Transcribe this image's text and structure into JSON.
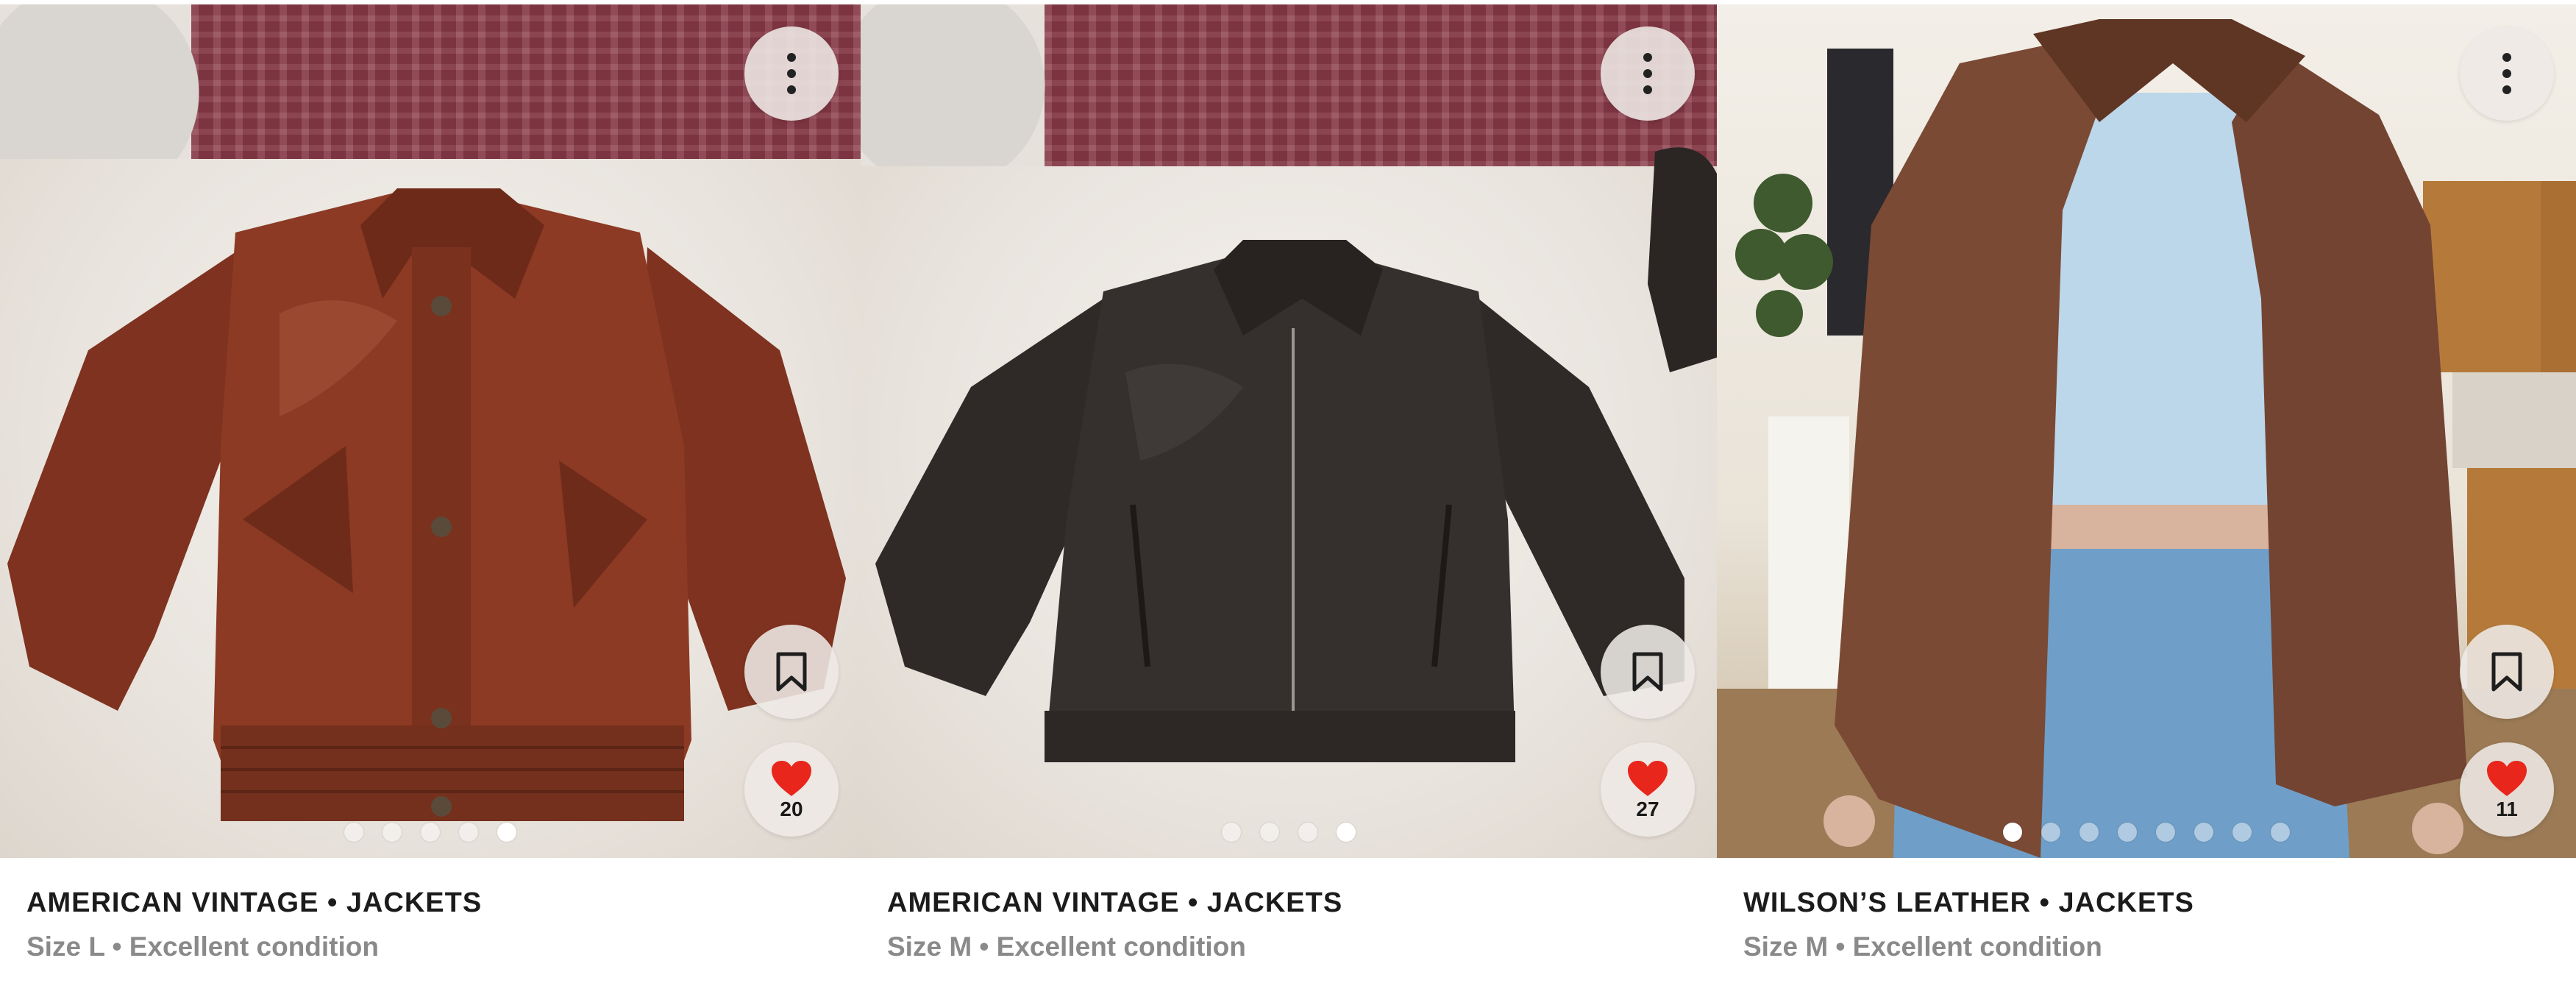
{
  "listings": [
    {
      "title": "AMERICAN VINTAGE • JACKETS",
      "details": "Size L • Excellent condition",
      "likes": "20",
      "images_count": 5,
      "active_image": 5,
      "jacket_color": "#8c3a24"
    },
    {
      "title": "AMERICAN VINTAGE • JACKETS",
      "details": "Size M • Excellent condition",
      "likes": "27",
      "images_count": 4,
      "active_image": 4,
      "jacket_color": "#35302d"
    },
    {
      "title": "WILSON’S LEATHER • JACKETS",
      "details": "Size M • Excellent condition",
      "likes": "11",
      "images_count": 8,
      "active_image": 1,
      "jacket_color": "#7a4a35"
    }
  ],
  "icons": {
    "menu": "kebab-menu-icon",
    "bookmark": "bookmark-icon",
    "like": "heart-icon"
  },
  "colors": {
    "heart": "#e8261c",
    "button_bg": "#eee9e6",
    "title": "#1b1b1b",
    "subtitle": "#8a8a8a"
  }
}
